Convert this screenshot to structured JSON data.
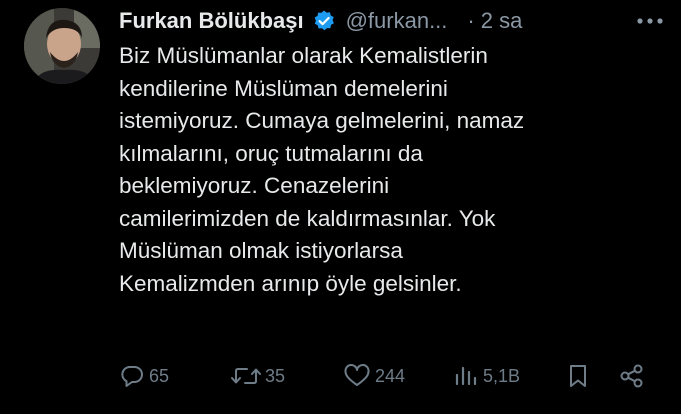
{
  "tweet": {
    "author": {
      "display_name": "Furkan Bölükbaşı",
      "handle": "@furkan...",
      "verified_icon": "verified-badge-icon"
    },
    "separator": "·",
    "timestamp": "2 sa",
    "text_lines": [
      "Biz Müslümanlar olarak Kemalistlerin",
      "kendilerine Müslüman demelerini",
      "istemiyoruz. Cumaya gelmelerini, namaz",
      "kılmalarını, oruç tutmalarını da",
      "beklemiyoruz. Cenazelerini",
      "camilerimizden de kaldırmasınlar. Yok",
      "Müslüman olmak istiyorlarsa",
      "Kemalizmden arınıp öyle gelsinler."
    ],
    "actions": {
      "replies": "65",
      "retweets": "35",
      "likes": "244",
      "views": "5,1B"
    }
  },
  "colors": {
    "background": "#000000",
    "text": "#e7e9ea",
    "muted": "#8b98a5",
    "icon": "#6e7c88",
    "verified": "#1d9bf0"
  },
  "icons": [
    "more-options-icon",
    "verified-badge-icon",
    "reply-icon",
    "retweet-icon",
    "like-icon",
    "views-icon",
    "bookmark-icon",
    "share-icon"
  ]
}
